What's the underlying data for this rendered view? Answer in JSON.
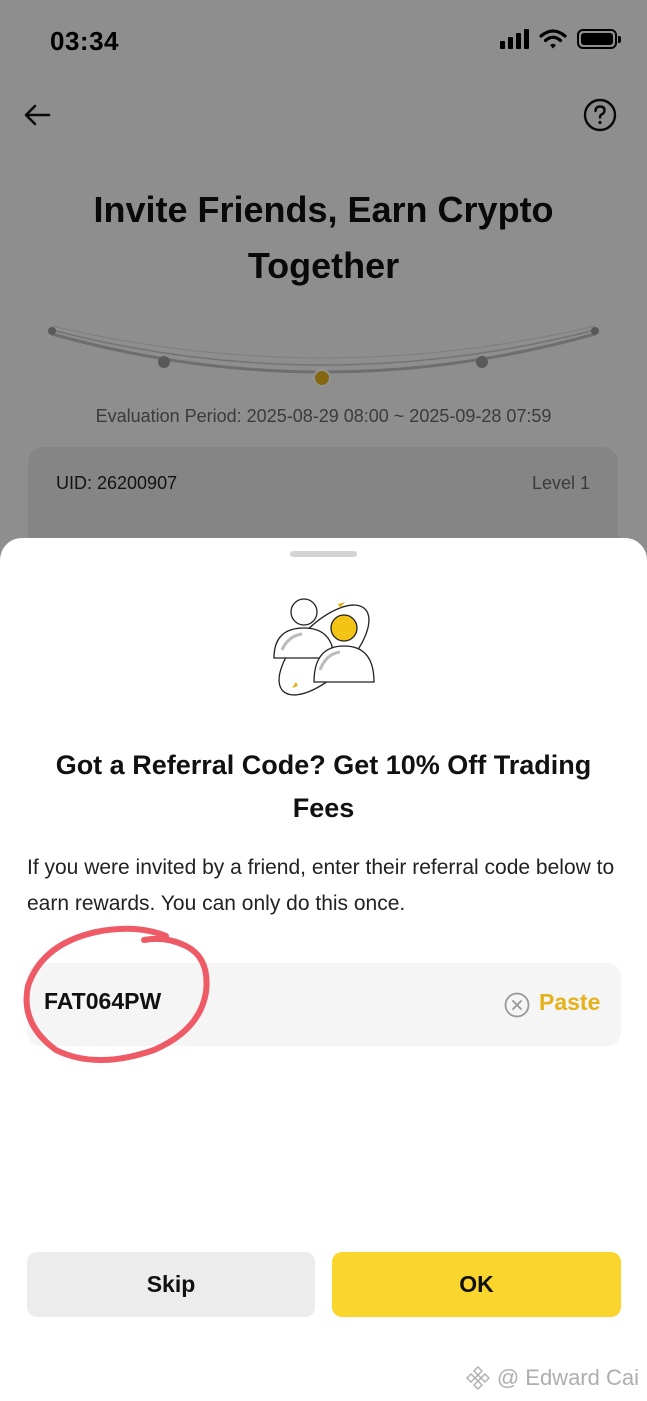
{
  "status_bar": {
    "time": "03:34",
    "icons": [
      "signal-icon",
      "wifi-icon",
      "battery-icon"
    ]
  },
  "header": {
    "back_icon": "arrow-left-icon",
    "help_icon": "question-circle-icon"
  },
  "hero": {
    "title": "Invite Friends, Earn Crypto Together",
    "evaluation_label": "Evaluation Period:",
    "evaluation_range": "2025-08-29 08:00 ~ 2025-09-28 07:59"
  },
  "uid_card": {
    "uid": "UID: 26200907",
    "level": "Level 1"
  },
  "sheet": {
    "title": "Got a Referral Code? Get 10% Off Trading Fees",
    "description": "If you were invited by a friend, enter their referral code below to earn rewards. You can only do this once.",
    "code_value": "FAT064PW",
    "clear_icon": "clear-circle-icon",
    "paste_label": "Paste",
    "skip_label": "Skip",
    "ok_label": "OK"
  },
  "watermark": {
    "text": "@ Edward Cai"
  },
  "colors": {
    "accent_yellow": "#fad52e",
    "paste_text": "#e5b21b",
    "annotation_red": "#ee5a66"
  }
}
